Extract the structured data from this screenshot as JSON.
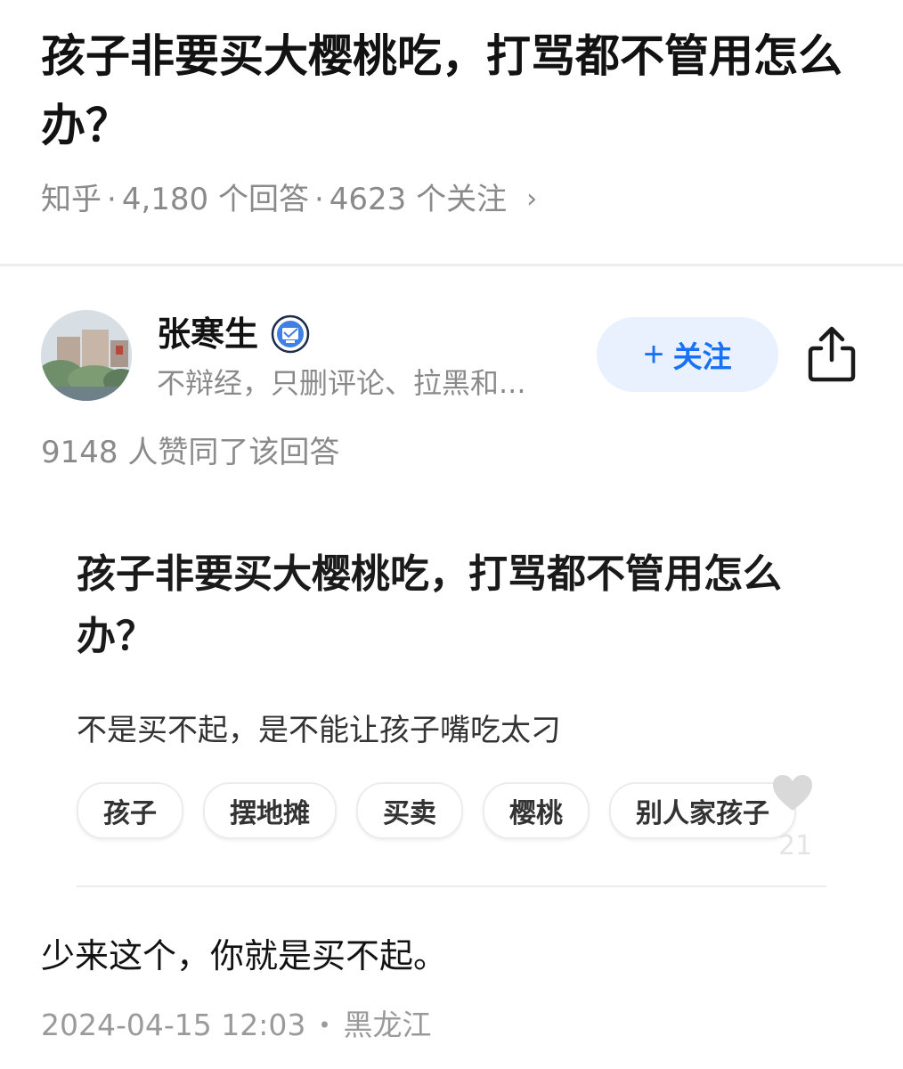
{
  "question": {
    "title": "孩子非要买大樱桃吃，打骂都不管用怎么办？",
    "source": "知乎",
    "separator": "·",
    "answers_count": "4,180 个回答",
    "followers_count": "4623 个关注",
    "chevron": "›"
  },
  "author": {
    "name": "张寒生",
    "bio": "不辩经，只删评论、拉黑和...",
    "avatar_icon": "avatar-photo",
    "badge_icon": "verified-badge-icon",
    "follow_label": "关注",
    "follow_plus": "+",
    "share_icon": "share-icon"
  },
  "upvote_summary": "9148 人赞同了该回答",
  "card": {
    "title": "孩子非要买大樱桃吃，打骂都不管用怎么办？",
    "subtitle": "不是买不起，是不能让孩子嘴吃太刁",
    "tags": [
      "孩子",
      "摆地摊",
      "买卖",
      "樱桃",
      "别人家孩子"
    ],
    "like_icon": "heart-icon",
    "like_count": "21"
  },
  "answer": {
    "body": "少来这个，你就是买不起。",
    "timestamp": "2024-04-15 12:03",
    "dot": "•",
    "location": "黑龙江"
  },
  "colors": {
    "accent": "#1772f6",
    "follow_bg": "#e8f1fd",
    "meta_text": "#8a8a8a"
  }
}
